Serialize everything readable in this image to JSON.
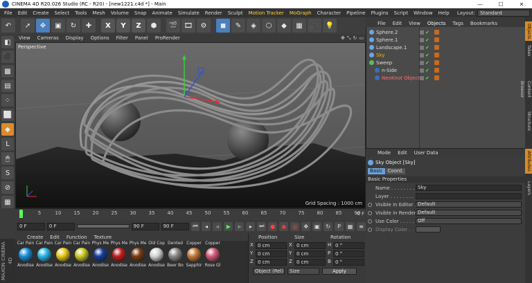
{
  "window": {
    "title": "CINEMA 4D R20.026 Studio (RC - R20) - [new1221.c4d *] - Main",
    "minimize": "—",
    "maximize": "☐",
    "close": "✕"
  },
  "menu": {
    "items": [
      "File",
      "Edit",
      "Create",
      "Select",
      "Tools",
      "Mesh",
      "Volume",
      "Snap",
      "Animate",
      "Simulate",
      "Render",
      "Sculpt",
      "Motion Tracker",
      "MoGraph",
      "Character",
      "Pipeline",
      "Plugins",
      "Script",
      "Window",
      "Help"
    ],
    "highlighted": [
      "Motion Tracker",
      "MoGraph"
    ],
    "layout_label": "Layout:",
    "layout_value": "Standard"
  },
  "toolbar": {
    "undo": "↶",
    "axis_x": "X",
    "axis_y": "Y",
    "axis_z": "Z"
  },
  "viewport": {
    "menu": [
      "View",
      "Cameras",
      "Display",
      "Options",
      "Filter",
      "Panel",
      "ProRender"
    ],
    "label": "Perspective",
    "grid_spacing": "Grid Spacing : 1000 cm"
  },
  "timeline": {
    "ticks": [
      "0",
      "5",
      "10",
      "15",
      "20",
      "25",
      "30",
      "35",
      "40",
      "45",
      "50",
      "55",
      "60",
      "65",
      "70",
      "75",
      "80",
      "85",
      "90"
    ],
    "current_frame": "0 F"
  },
  "transport": {
    "start": "0 F",
    "current": "0 F",
    "end_range": "90 F",
    "end": "90 F"
  },
  "materials": {
    "menu": [
      "Create",
      "Edit",
      "Function",
      "Texture"
    ],
    "items": [
      {
        "top": "Car Pain",
        "bottom": "Anodise",
        "color": "#1a8fd8"
      },
      {
        "top": "Car Pain",
        "bottom": "Anodise",
        "color": "#29b6e6"
      },
      {
        "top": "Car Pain",
        "bottom": "Anodise",
        "color": "#e8c81a"
      },
      {
        "top": "Car Pain",
        "bottom": "Anodise",
        "color": "#c9c927"
      },
      {
        "top": "Phys Me",
        "bottom": "Anodise",
        "color": "#163e9c"
      },
      {
        "top": "Phys Me",
        "bottom": "Anodise",
        "color": "#c21e1e"
      },
      {
        "top": "Phys Me",
        "bottom": "Anodise",
        "color": "#7a3c12"
      },
      {
        "top": "Old Cop",
        "bottom": "Anodise",
        "color": "#d4d4d4"
      },
      {
        "top": "Dented",
        "bottom": "Beer Bo",
        "color": "#8a8a8a"
      },
      {
        "top": "Copper",
        "bottom": "Sapphir",
        "color": "#c57a3c"
      },
      {
        "top": "Copper",
        "bottom": "Rose Gl",
        "color": "#d65a7a"
      }
    ]
  },
  "coordinates": {
    "headers": {
      "position": "Position",
      "size": "Size",
      "rotation": "Rotation"
    },
    "rows": [
      {
        "axis": "X",
        "pos": "0 cm",
        "size": "0 cm",
        "rot_label": "H",
        "rot": "0 °"
      },
      {
        "axis": "Y",
        "pos": "0 cm",
        "size": "0 cm",
        "rot_label": "P",
        "rot": "0 °"
      },
      {
        "axis": "Z",
        "pos": "0 cm",
        "size": "0 cm",
        "rot_label": "B",
        "rot": "0 °"
      }
    ],
    "mode": "Object (Rel)",
    "size_mode": "Size",
    "apply": "Apply"
  },
  "objects": {
    "menu": [
      "File",
      "Edit",
      "View",
      "Objects",
      "Tags",
      "Bookmarks"
    ],
    "active_menu": "Objects",
    "items": [
      {
        "name": "Sphere.2",
        "indent": 0,
        "style": "normal",
        "icon_color": "#6aa6e6"
      },
      {
        "name": "Sphere.1",
        "indent": 0,
        "style": "normal",
        "icon_color": "#6aa6e6"
      },
      {
        "name": "Landscape.1",
        "indent": 0,
        "style": "normal",
        "icon_color": "#6aa6e6"
      },
      {
        "name": "Sky",
        "indent": 0,
        "style": "hl",
        "icon_color": "#6aa6e6"
      },
      {
        "name": "Sweep",
        "indent": 0,
        "style": "normal",
        "icon_color": "#55c155"
      },
      {
        "name": "n-Side",
        "indent": 1,
        "style": "normal",
        "icon_color": "#3a6fbf"
      },
      {
        "name": "NeoKnot Object",
        "indent": 1,
        "style": "red",
        "icon_color": "#3a6fbf"
      }
    ]
  },
  "attributes": {
    "menu": [
      "Mode",
      "Edit",
      "User Data"
    ],
    "title": "Sky Object [Sky]",
    "tabs": [
      "Basic",
      "Coord."
    ],
    "section": "Basic Properties",
    "rows": [
      {
        "label": "Name . . . . . . . . . . .",
        "value": "Sky",
        "kind": "text"
      },
      {
        "label": "Layer . . . . . . . . . . .",
        "value": "",
        "kind": "text"
      },
      {
        "label": "Visible in Editor . .",
        "value": "Default",
        "kind": "drop"
      },
      {
        "label": "Visible in Renderer",
        "value": "Default",
        "kind": "drop"
      },
      {
        "label": "Use Color . . . . . . .",
        "value": "Off",
        "kind": "drop"
      },
      {
        "label": "Display Color . . . .",
        "value": "",
        "kind": "color"
      }
    ]
  },
  "sidetabs": [
    "Objects",
    "Takes",
    "Content Browser",
    "Structure",
    "Attributes",
    "Layers"
  ],
  "maxon_label": "MAXON CINEMA 4D"
}
